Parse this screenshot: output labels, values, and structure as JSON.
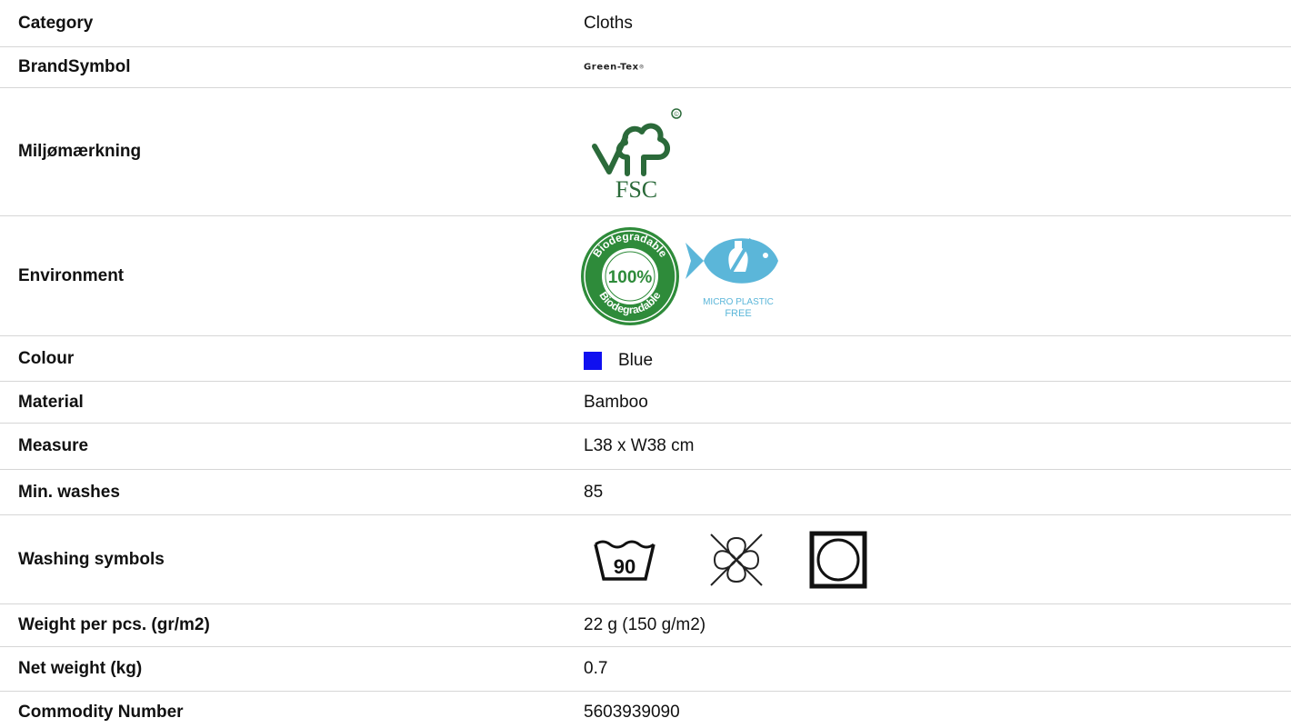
{
  "rows": [
    {
      "label": "Category",
      "value": "Cloths"
    },
    {
      "label": "BrandSymbol",
      "brand_logo_text": "Green-Tex",
      "brand_logo_mark": "®"
    },
    {
      "label": "Miljømærkning",
      "fsc_text": "FSC",
      "fsc_mark": "©",
      "icon": "fsc-tree-icon"
    },
    {
      "label": "Environment",
      "badge_percent": "100%",
      "badge_ring_text": "Biodegradable",
      "fish_text_1": "MICRO PLASTIC",
      "fish_text_2": "FREE",
      "icons": [
        "biodegradable-badge-icon",
        "micro-plastic-free-fish-icon"
      ]
    },
    {
      "label": "Colour",
      "value": "Blue",
      "swatch_color": "#1010f0"
    },
    {
      "label": "Material",
      "value": "Bamboo"
    },
    {
      "label": "Measure",
      "value": "L38 x W38 cm"
    },
    {
      "label": "Min. washes",
      "value": "85"
    },
    {
      "label": "Washing symbols",
      "wash_temp": "90",
      "icons": [
        "wash-90-icon",
        "do-not-dry-clean-icon",
        "tumble-dry-icon"
      ]
    },
    {
      "label": "Weight per pcs. (gr/m2)",
      "value": "22 g (150 g/m2)"
    },
    {
      "label": "Net weight (kg)",
      "value": "0.7"
    },
    {
      "label": "Commodity Number",
      "value": "5603939090"
    }
  ],
  "colors": {
    "divider": "#d6d6d6",
    "fsc_green": "#2b6a3a",
    "badge_green": "#2e8b3a",
    "fish_blue": "#5bb6d9"
  }
}
